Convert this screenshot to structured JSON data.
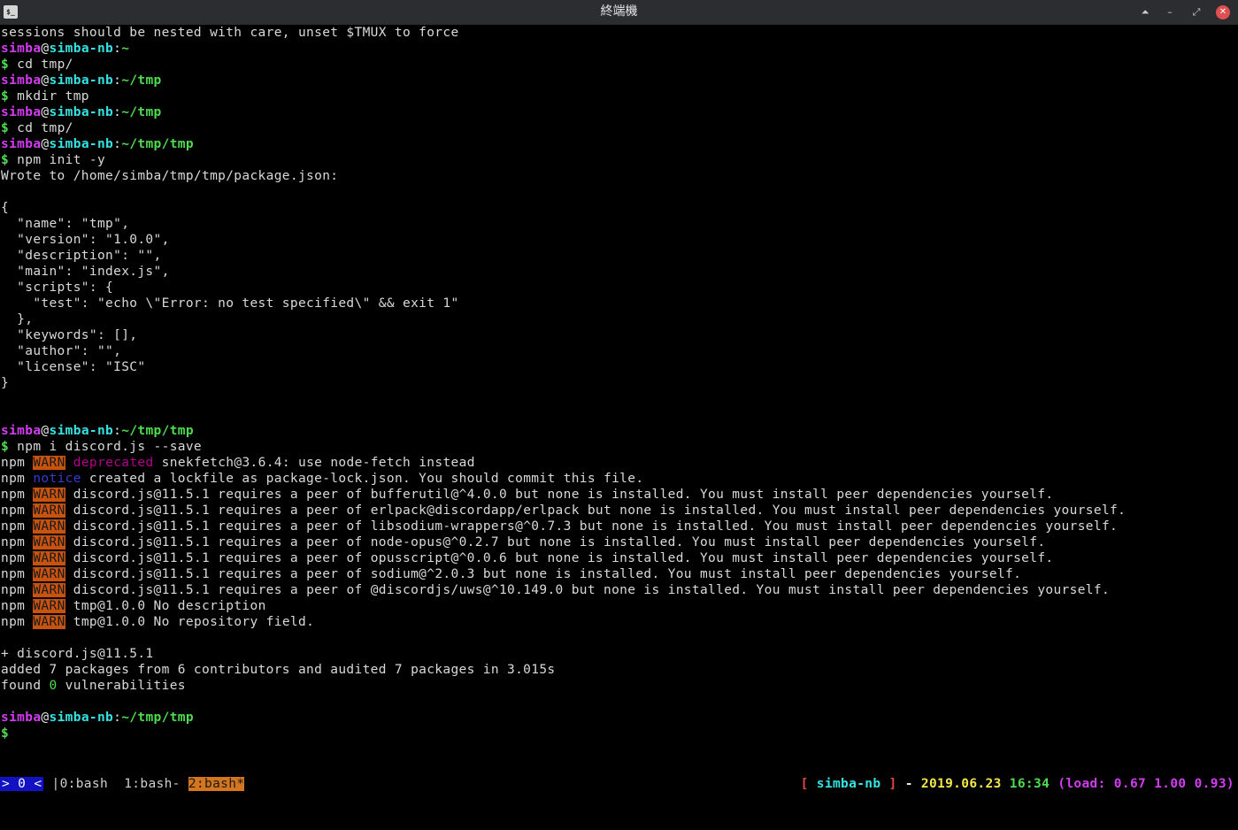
{
  "window": {
    "title": "終端機",
    "icon_label": "$_",
    "buttons": {
      "shade": "⏶",
      "minimize": "–",
      "maximize": "⤢",
      "close": "✕"
    }
  },
  "prompt": {
    "user": "simba",
    "at": "@",
    "host": "simba-nb",
    "sep": ":",
    "dollar": "$"
  },
  "terminal": {
    "l1": "sessions should be nested with care, unset $TMUX to force",
    "p1_path": "~",
    "c1": " cd tmp/",
    "p2_path": "~/tmp",
    "c2": " mkdir tmp",
    "p3_path": "~/tmp",
    "c3": " cd tmp/",
    "p4_path": "~/tmp/tmp",
    "c4": " npm init -y",
    "wrote": "Wrote to /home/simba/tmp/tmp/package.json:",
    "json": [
      "{",
      "  \"name\": \"tmp\",",
      "  \"version\": \"1.0.0\",",
      "  \"description\": \"\",",
      "  \"main\": \"index.js\",",
      "  \"scripts\": {",
      "    \"test\": \"echo \\\"Error: no test specified\\\" && exit 1\"",
      "  },",
      "  \"keywords\": [],",
      "  \"author\": \"\",",
      "  \"license\": \"ISC\"",
      "}"
    ],
    "p5_path": "~/tmp/tmp",
    "c5": " npm i discord.js --save",
    "npm": "npm",
    "warn": "WARN",
    "deprecated": "deprecated",
    "dep_msg": " snekfetch@3.6.4: use node-fetch instead",
    "notice": "notice",
    "notice_msg": " created a lockfile as package-lock.json. You should commit this file.",
    "warns": [
      " discord.js@11.5.1 requires a peer of bufferutil@^4.0.0 but none is installed. You must install peer dependencies yourself.",
      " discord.js@11.5.1 requires a peer of erlpack@discordapp/erlpack but none is installed. You must install peer dependencies yourself.",
      " discord.js@11.5.1 requires a peer of libsodium-wrappers@^0.7.3 but none is installed. You must install peer dependencies yourself.",
      " discord.js@11.5.1 requires a peer of node-opus@^0.2.7 but none is installed. You must install peer dependencies yourself.",
      " discord.js@11.5.1 requires a peer of opusscript@^0.0.6 but none is installed. You must install peer dependencies yourself.",
      " discord.js@11.5.1 requires a peer of sodium@^2.0.3 but none is installed. You must install peer dependencies yourself.",
      " discord.js@11.5.1 requires a peer of @discordjs/uws@^10.149.0 but none is installed. You must install peer dependencies yourself.",
      " tmp@1.0.0 No description",
      " tmp@1.0.0 No repository field."
    ],
    "plus": "+ discord.js@11.5.1",
    "added": "added 7 packages from 6 contributors and audited 7 packages in 3.015s",
    "found_a": "found ",
    "found_n": "0",
    "found_b": " vulnerabilities",
    "p6_path": "~/tmp/tmp"
  },
  "statusbar": {
    "session": "> 0 <",
    "win0": " |0:bash ",
    "win1": " 1:bash- ",
    "win2": "2:bash*",
    "br_open": "[ ",
    "host": "simba-nb",
    "br_close": " ]",
    "dash": " - ",
    "date": "2019.06.23",
    "time": " 16:34",
    "load": " (load: 0.67 1.00 0.93)"
  }
}
